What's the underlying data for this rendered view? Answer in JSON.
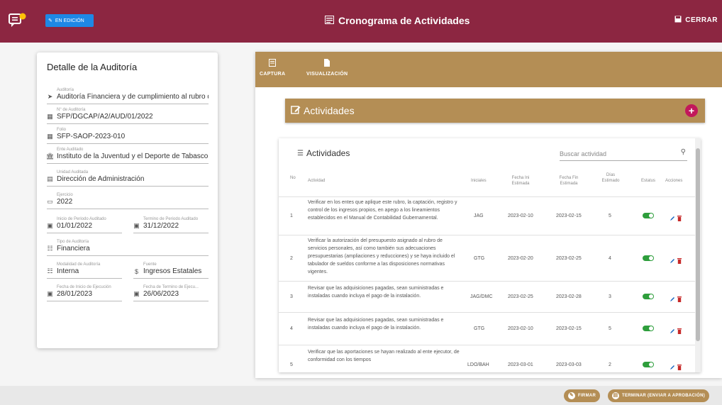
{
  "header": {
    "status_chip": "EN EDICIÓN",
    "title": "Cronograma de Actividades",
    "close_label": "CERRAR",
    "color": "#8c2641"
  },
  "detail": {
    "title": "Detalle de la Auditoría",
    "fields": {
      "auditoria": {
        "label": "Auditoría",
        "value": "Auditoría Financiera y de cumplimiento al rubro de S"
      },
      "numero": {
        "label": "N° de Auditoría",
        "value": "SFP/DGCAP/A2/AUD/01/2022"
      },
      "folio": {
        "label": "Folio",
        "value": "SFP-SAOP-2023-010"
      },
      "ente": {
        "label": "Ente Auditado",
        "value": "Instituto de la Juventud y el Deporte de Tabasco"
      },
      "unidad": {
        "label": "Unidad Auditada",
        "value": "Dirección de Administración"
      },
      "ejercicio": {
        "label": "Ejercicio",
        "value": "2022"
      },
      "inicio_periodo": {
        "label": "Inicio de Periodo Auditado",
        "value": "01/01/2022"
      },
      "termino_periodo": {
        "label": "Termino de Periodo Auditado",
        "value": "31/12/2022"
      },
      "tipo": {
        "label": "Tipo de Auditoría",
        "value": "Financiera"
      },
      "modalidad": {
        "label": "Modalidad de Auditoría",
        "value": "Interna"
      },
      "fuente": {
        "label": "Fuente",
        "value": "Ingresos Estatales"
      },
      "inicio_ejecucion": {
        "label": "Fecha de Inicio de Ejecución",
        "value": "28/01/2023"
      },
      "termino_ejecucion": {
        "label": "Fecha de Termino de Ejecu...",
        "value": "26/06/2023"
      }
    }
  },
  "tabs": [
    {
      "label": "CAPTURA",
      "icon": "edit-note-icon"
    },
    {
      "label": "VISUALIZACIÓN",
      "icon": "file-view-icon"
    }
  ],
  "actividades_header": "Actividades",
  "table": {
    "title": "Actividades",
    "search_placeholder": "Buscar actividad",
    "columns": [
      "No",
      "Actividad",
      "Iniciales",
      "Fecha Ini Estimada",
      "Fecha Fin Estimada",
      "Días Estimado",
      "Estatus",
      "Acciones"
    ],
    "rows": [
      {
        "no": "1",
        "actividad": "Verificar en los entes que aplique este rubro, la captación, registro y control de los ingresos propios, en apego a los lineamientos establecidos en el Manual de Contabilidad Gubernamental.",
        "iniciales": "JAG",
        "inicio": "2023-02-10",
        "fin": "2023-02-15",
        "dias": "5"
      },
      {
        "no": "2",
        "actividad": "Verificar la autorización del presupuesto asignado al rubro de servicios personales, así como también sus adecuaciones presupuestarias (ampliaciones y reducciones) y se haya incluido el tabulador de sueldos conforme a las disposiciones normativas vigentes.",
        "iniciales": "GTG",
        "inicio": "2023-02-20",
        "fin": "2023-02-25",
        "dias": "4"
      },
      {
        "no": "3",
        "actividad": "Revisar que las adquisiciones pagadas, sean suministradas e instaladas cuando incluya el pago de la instalación.",
        "iniciales": "JAG/DMC",
        "inicio": "2023-02-25",
        "fin": "2023-02-28",
        "dias": "3"
      },
      {
        "no": "4",
        "actividad": "Revisar que las adquisiciones pagadas, sean suministradas e instaladas cuando incluya el pago de la instalación.",
        "iniciales": "GTG",
        "inicio": "2023-02-10",
        "fin": "2023-02-15",
        "dias": "5"
      },
      {
        "no": "5",
        "actividad": "Verificar que las aportaciones se hayan realizado al ente ejecutor, de conformidad con los tiempos",
        "iniciales": "LDO/BAH",
        "inicio": "2023-03-01",
        "fin": "2023-03-03",
        "dias": "2"
      }
    ]
  },
  "footer": {
    "firmar": "FIRMAR",
    "terminar": "TERMINAR (ENVIAR A APROBACIÓN)"
  },
  "colors": {
    "accent": "#b48e55",
    "toggle": "#2e9e3c",
    "edit": "#1565c0",
    "delete": "#c62828"
  }
}
